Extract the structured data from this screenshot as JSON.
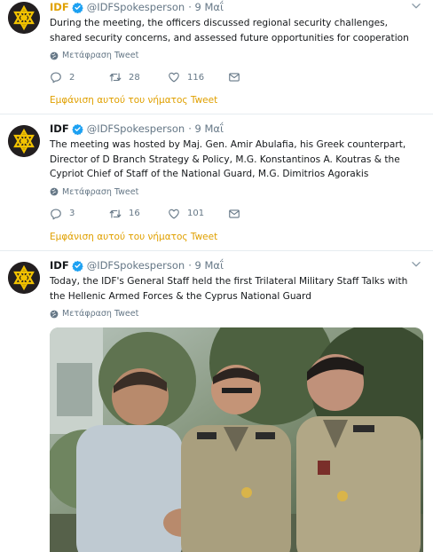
{
  "colors": {
    "accent": "#e0a000",
    "muted": "#657786",
    "text": "#14171a",
    "verified": "#1da1f2",
    "divider": "#e6ecf0"
  },
  "tweets": [
    {
      "name": "IDF",
      "handle": "@IDFSpokesperson",
      "date": "· 9 Μαΐ",
      "text": "During the meeting, the officers discussed regional security challenges, shared security concerns, and assessed future opportunities for cooperation",
      "translate": "Μετάφραση Tweet",
      "replies": "2",
      "retweets": "28",
      "likes": "116",
      "thread": "Εμφάνιση αυτού του νήματος Tweet"
    },
    {
      "name": "IDF",
      "handle": "@IDFSpokesperson",
      "date": "· 9 Μαΐ",
      "text": "The meeting was hosted by Maj. Gen. Amir Abulafia, his Greek counterpart, Director of D Branch Strategy & Policy, M.G. Konstantinos A. Koutras & the Cypriot Chief of Staff of the National Guard, M.G. Dimitrios Agorakis",
      "translate": "Μετάφραση Tweet",
      "replies": "3",
      "retweets": "16",
      "likes": "101",
      "thread": "Εμφάνιση αυτού του νήματος Tweet"
    },
    {
      "name": "IDF",
      "handle": "@IDFSpokesperson",
      "date": "· 9 Μαΐ",
      "text": "Today, the IDF's General Staff held the first Trilateral Military Staff Talks with the Hellenic Armed Forces & the Cyprus National Guard",
      "translate": "Μετάφραση Tweet"
    }
  ],
  "icons": {
    "avatar": "idf-logo-icon",
    "verified": "verified-badge-icon",
    "caret": "chevron-down-icon",
    "translate": "globe-icon",
    "reply": "reply-icon",
    "retweet": "retweet-icon",
    "like": "heart-icon",
    "dm": "envelope-icon"
  }
}
